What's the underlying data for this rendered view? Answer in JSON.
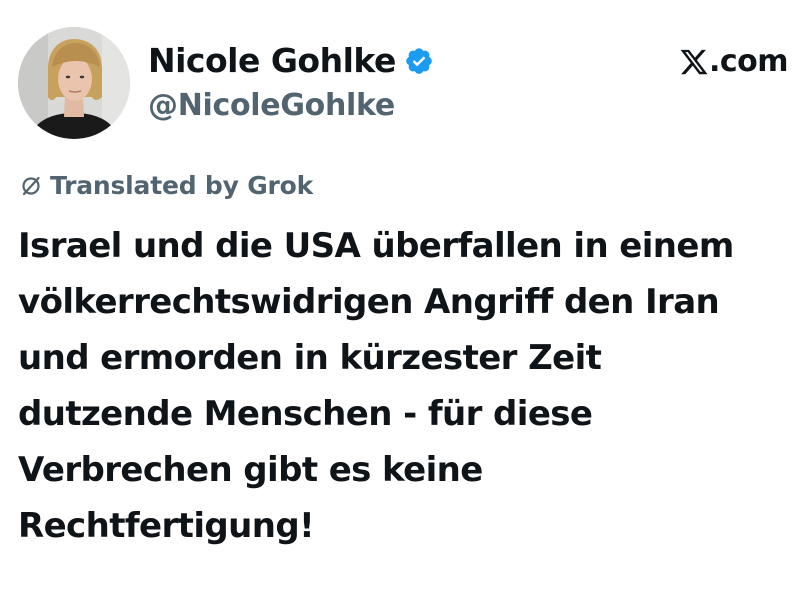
{
  "author": {
    "display_name": "Nicole Gohlke",
    "handle": "@NicoleGohlke",
    "verified": true,
    "avatar_icon": "profile-photo"
  },
  "brand": {
    "label": ".com",
    "logo_icon": "x-logo-icon"
  },
  "translation": {
    "label": "Translated by Grok",
    "icon": "grok-icon"
  },
  "post": {
    "lines": [
      "Israel und die USA überfallen in einem",
      "völkerrechtswidrigen Angriff den Iran",
      "und ermorden in kürzester Zeit",
      "dutzende Menschen - für diese",
      "Verbrechen gibt es keine",
      "Rechtfertigung!"
    ]
  },
  "colors": {
    "text_primary": "#0f1419",
    "text_secondary": "#536471",
    "verified_blue": "#1d9bf0",
    "background": "#ffffff"
  }
}
